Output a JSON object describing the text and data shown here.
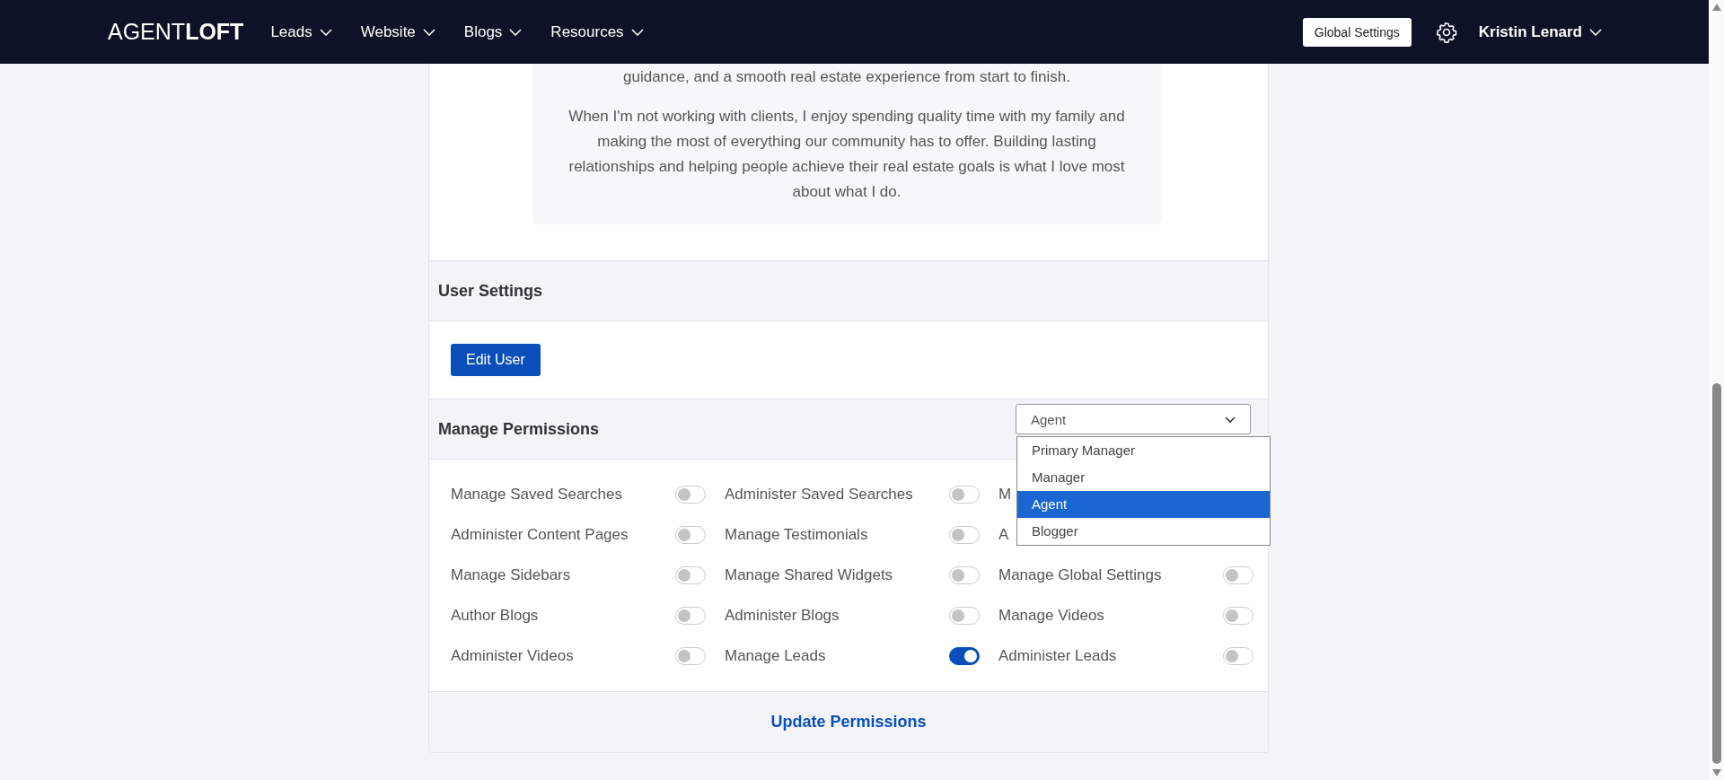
{
  "nav": {
    "logo": "AGENT**LOFT**",
    "menus": [
      {
        "label": "Leads"
      },
      {
        "label": "Website"
      },
      {
        "label": "Blogs"
      },
      {
        "label": "Resources"
      }
    ],
    "global_settings": "Global Settings",
    "user": "Kristin Lenard"
  },
  "bio": {
    "paragraphs": [
      "guidance, and a smooth real estate experience from start to finish.",
      "When I'm not working with clients, I enjoy spending quality time with my family and making the most of everything our community has to offer. Building lasting relationships and helping people achieve their real estate goals is what I love most about what I do."
    ]
  },
  "user_settings": {
    "title": "User Settings",
    "button": "Edit User"
  },
  "permissions": {
    "title": "Manage Permissions",
    "role_select": {
      "value": "Agent",
      "options": [
        {
          "label": "Primary Manager",
          "selected": false
        },
        {
          "label": "Manager",
          "selected": false
        },
        {
          "label": "Agent",
          "selected": true
        },
        {
          "label": "Blogger",
          "selected": false
        }
      ]
    },
    "items": [
      {
        "label": "Manage Saved Searches",
        "on": false
      },
      {
        "label": "Administer Saved Searches",
        "on": false
      },
      {
        "label": "M"
      },
      {
        "label": "Administer Content Pages",
        "on": false
      },
      {
        "label": "Manage Testimonials",
        "on": false
      },
      {
        "label": "A"
      },
      {
        "label": "Manage Sidebars",
        "on": false
      },
      {
        "label": "Manage Shared Widgets",
        "on": false
      },
      {
        "label": "Manage Global Settings",
        "on": false
      },
      {
        "label": "Author Blogs",
        "on": false
      },
      {
        "label": "Administer Blogs",
        "on": false
      },
      {
        "label": "Manage Videos",
        "on": false
      },
      {
        "label": "Administer Videos",
        "on": false
      },
      {
        "label": "Manage Leads",
        "on": true
      },
      {
        "label": "Administer Leads",
        "on": false
      }
    ],
    "update": "Update Permissions"
  }
}
